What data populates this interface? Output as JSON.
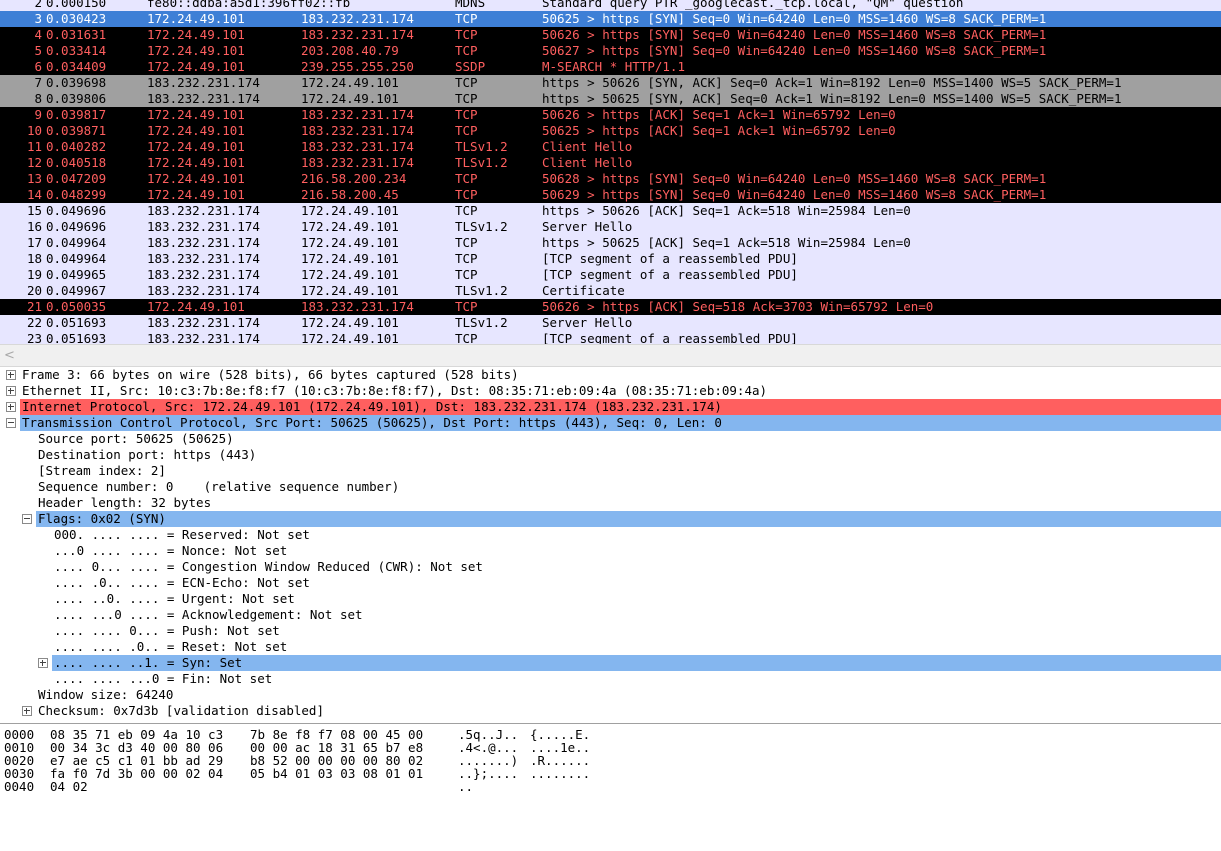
{
  "packets": [
    {
      "no": "2",
      "time": "0.000150",
      "src": "fe80::ddba:a5d1:396ff02::fb",
      "dst": "",
      "proto": "MDNS",
      "info": "Standard query PTR _googlecast._tcp.local, \"QM\" question",
      "style": "mdns"
    },
    {
      "no": "3",
      "time": "0.030423",
      "src": "172.24.49.101",
      "dst": "183.232.231.174",
      "proto": "TCP",
      "info": "50625 > https [SYN] Seq=0 Win=64240 Len=0 MSS=1460 WS=8 SACK_PERM=1",
      "style": "selected"
    },
    {
      "no": "4",
      "time": "0.031631",
      "src": "172.24.49.101",
      "dst": "183.232.231.174",
      "proto": "TCP",
      "info": "50626 > https [SYN] Seq=0 Win=64240 Len=0 MSS=1460 WS=8 SACK_PERM=1",
      "style": "bad"
    },
    {
      "no": "5",
      "time": "0.033414",
      "src": "172.24.49.101",
      "dst": "203.208.40.79",
      "proto": "TCP",
      "info": "50627 > https [SYN] Seq=0 Win=64240 Len=0 MSS=1460 WS=8 SACK_PERM=1",
      "style": "bad"
    },
    {
      "no": "6",
      "time": "0.034409",
      "src": "172.24.49.101",
      "dst": "239.255.255.250",
      "proto": "SSDP",
      "info": "M-SEARCH * HTTP/1.1",
      "style": "bad"
    },
    {
      "no": "7",
      "time": "0.039698",
      "src": "183.232.231.174",
      "dst": "172.24.49.101",
      "proto": "TCP",
      "info": "https > 50626 [SYN, ACK] Seq=0 Ack=1 Win=8192 Len=0 MSS=1400 WS=5 SACK_PERM=1",
      "style": "grey"
    },
    {
      "no": "8",
      "time": "0.039806",
      "src": "183.232.231.174",
      "dst": "172.24.49.101",
      "proto": "TCP",
      "info": "https > 50625 [SYN, ACK] Seq=0 Ack=1 Win=8192 Len=0 MSS=1400 WS=5 SACK_PERM=1",
      "style": "grey"
    },
    {
      "no": "9",
      "time": "0.039817",
      "src": "172.24.49.101",
      "dst": "183.232.231.174",
      "proto": "TCP",
      "info": "50626 > https [ACK] Seq=1 Ack=1 Win=65792 Len=0",
      "style": "bad"
    },
    {
      "no": "10",
      "time": "0.039871",
      "src": "172.24.49.101",
      "dst": "183.232.231.174",
      "proto": "TCP",
      "info": "50625 > https [ACK] Seq=1 Ack=1 Win=65792 Len=0",
      "style": "bad"
    },
    {
      "no": "11",
      "time": "0.040282",
      "src": "172.24.49.101",
      "dst": "183.232.231.174",
      "proto": "TLSv1.2",
      "info": "Client Hello",
      "style": "bad"
    },
    {
      "no": "12",
      "time": "0.040518",
      "src": "172.24.49.101",
      "dst": "183.232.231.174",
      "proto": "TLSv1.2",
      "info": "Client Hello",
      "style": "bad"
    },
    {
      "no": "13",
      "time": "0.047209",
      "src": "172.24.49.101",
      "dst": "216.58.200.234",
      "proto": "TCP",
      "info": "50628 > https [SYN] Seq=0 Win=64240 Len=0 MSS=1460 WS=8 SACK_PERM=1",
      "style": "bad"
    },
    {
      "no": "14",
      "time": "0.048299",
      "src": "172.24.49.101",
      "dst": "216.58.200.45",
      "proto": "TCP",
      "info": "50629 > https [SYN] Seq=0 Win=64240 Len=0 MSS=1460 WS=8 SACK_PERM=1",
      "style": "bad"
    },
    {
      "no": "15",
      "time": "0.049696",
      "src": "183.232.231.174",
      "dst": "172.24.49.101",
      "proto": "TCP",
      "info": "https > 50626 [ACK] Seq=1 Ack=518 Win=25984 Len=0",
      "style": "tcp-plain"
    },
    {
      "no": "16",
      "time": "0.049696",
      "src": "183.232.231.174",
      "dst": "172.24.49.101",
      "proto": "TLSv1.2",
      "info": "Server Hello",
      "style": "tcp-plain"
    },
    {
      "no": "17",
      "time": "0.049964",
      "src": "183.232.231.174",
      "dst": "172.24.49.101",
      "proto": "TCP",
      "info": "https > 50625 [ACK] Seq=1 Ack=518 Win=25984 Len=0",
      "style": "tcp-plain"
    },
    {
      "no": "18",
      "time": "0.049964",
      "src": "183.232.231.174",
      "dst": "172.24.49.101",
      "proto": "TCP",
      "info": "[TCP segment of a reassembled PDU]",
      "style": "tcp-plain"
    },
    {
      "no": "19",
      "time": "0.049965",
      "src": "183.232.231.174",
      "dst": "172.24.49.101",
      "proto": "TCP",
      "info": "[TCP segment of a reassembled PDU]",
      "style": "tcp-plain"
    },
    {
      "no": "20",
      "time": "0.049967",
      "src": "183.232.231.174",
      "dst": "172.24.49.101",
      "proto": "TLSv1.2",
      "info": "Certificate",
      "style": "tcp-plain"
    },
    {
      "no": "21",
      "time": "0.050035",
      "src": "172.24.49.101",
      "dst": "183.232.231.174",
      "proto": "TCP",
      "info": "50626 > https [ACK] Seq=518 Ack=3703 Win=65792 Len=0",
      "style": "bad"
    },
    {
      "no": "22",
      "time": "0.051693",
      "src": "183.232.231.174",
      "dst": "172.24.49.101",
      "proto": "TLSv1.2",
      "info": "Server Hello",
      "style": "tcp-plain"
    },
    {
      "no": "23",
      "time": "0.051693",
      "src": "183.232.231.174",
      "dst": "172.24.49.101",
      "proto": "TCP",
      "info": "[TCP segment of a reassembled PDU]",
      "style": "tcp-plain"
    }
  ],
  "details": [
    {
      "text": "Frame 3: 66 bytes on wire (528 bits), 66 bytes captured (528 bits)",
      "indent": 0,
      "expander": "plus",
      "hl": ""
    },
    {
      "text": "Ethernet II, Src: 10:c3:7b:8e:f8:f7 (10:c3:7b:8e:f8:f7), Dst: 08:35:71:eb:09:4a (08:35:71:eb:09:4a)",
      "indent": 0,
      "expander": "plus",
      "hl": ""
    },
    {
      "text": "Internet Protocol, Src: 172.24.49.101 (172.24.49.101), Dst: 183.232.231.174 (183.232.231.174)",
      "indent": 0,
      "expander": "plus",
      "hl": "red"
    },
    {
      "text": "Transmission Control Protocol, Src Port: 50625 (50625), Dst Port: https (443), Seq: 0, Len: 0",
      "indent": 0,
      "expander": "minus",
      "hl": "blue"
    },
    {
      "text": "Source port: 50625 (50625)",
      "indent": 1,
      "expander": "",
      "hl": ""
    },
    {
      "text": "Destination port: https (443)",
      "indent": 1,
      "expander": "",
      "hl": ""
    },
    {
      "text": "[Stream index: 2]",
      "indent": 1,
      "expander": "",
      "hl": ""
    },
    {
      "text": "Sequence number: 0    (relative sequence number)",
      "indent": 1,
      "expander": "",
      "hl": ""
    },
    {
      "text": "Header length: 32 bytes",
      "indent": 1,
      "expander": "",
      "hl": ""
    },
    {
      "text": "Flags: 0x02 (SYN)",
      "indent": 1,
      "expander": "minus",
      "hl": "blue"
    },
    {
      "text": "000. .... .... = Reserved: Not set",
      "indent": 2,
      "expander": "",
      "hl": ""
    },
    {
      "text": "...0 .... .... = Nonce: Not set",
      "indent": 2,
      "expander": "",
      "hl": ""
    },
    {
      "text": ".... 0... .... = Congestion Window Reduced (CWR): Not set",
      "indent": 2,
      "expander": "",
      "hl": ""
    },
    {
      "text": ".... .0.. .... = ECN-Echo: Not set",
      "indent": 2,
      "expander": "",
      "hl": ""
    },
    {
      "text": ".... ..0. .... = Urgent: Not set",
      "indent": 2,
      "expander": "",
      "hl": ""
    },
    {
      "text": ".... ...0 .... = Acknowledgement: Not set",
      "indent": 2,
      "expander": "",
      "hl": ""
    },
    {
      "text": ".... .... 0... = Push: Not set",
      "indent": 2,
      "expander": "",
      "hl": ""
    },
    {
      "text": ".... .... .0.. = Reset: Not set",
      "indent": 2,
      "expander": "",
      "hl": ""
    },
    {
      "text": ".... .... ..1. = Syn: Set",
      "indent": 2,
      "expander": "plus",
      "hl": "blue"
    },
    {
      "text": ".... .... ...0 = Fin: Not set",
      "indent": 2,
      "expander": "",
      "hl": ""
    },
    {
      "text": "Window size: 64240",
      "indent": 1,
      "expander": "",
      "hl": ""
    },
    {
      "text": "Checksum: 0x7d3b [validation disabled]",
      "indent": 1,
      "expander": "plus",
      "hl": ""
    }
  ],
  "hex": [
    {
      "offset": "0000",
      "bytes1": "08 35 71 eb 09 4a 10 c3",
      "bytes2": "7b 8e f8 f7 08 00 45 00",
      "ascii1": ".5q..J..",
      "ascii2": "{.....E."
    },
    {
      "offset": "0010",
      "bytes1": "00 34 3c d3 40 00 80 06",
      "bytes2": "00 00 ac 18 31 65 b7 e8",
      "ascii1": ".4<.@...",
      "ascii2": "....1e.."
    },
    {
      "offset": "0020",
      "bytes1": "e7 ae c5 c1 01 bb ad 29",
      "bytes2": "b8 52 00 00 00 00 80 02",
      "ascii1": ".......)",
      "ascii2": ".R......"
    },
    {
      "offset": "0030",
      "bytes1": "fa f0 7d 3b 00 00 02 04",
      "bytes2": "05 b4 01 03 03 08 01 01",
      "ascii1": "..};....",
      "ascii2": "........"
    },
    {
      "offset": "0040",
      "bytes1": "04 02",
      "bytes2": "",
      "ascii1": "..",
      "ascii2": ""
    }
  ],
  "scrollbar": {
    "left_arrow": "<"
  },
  "colors": {
    "selected": "#3e7fd6",
    "bad_bg": "#000000",
    "bad_fg": "#ff5f5f",
    "grey": "#a0a0a0",
    "tcp": "#e7e6ff",
    "ip_hl": "#ff5f5f",
    "tcp_hl": "#84b6ef"
  }
}
